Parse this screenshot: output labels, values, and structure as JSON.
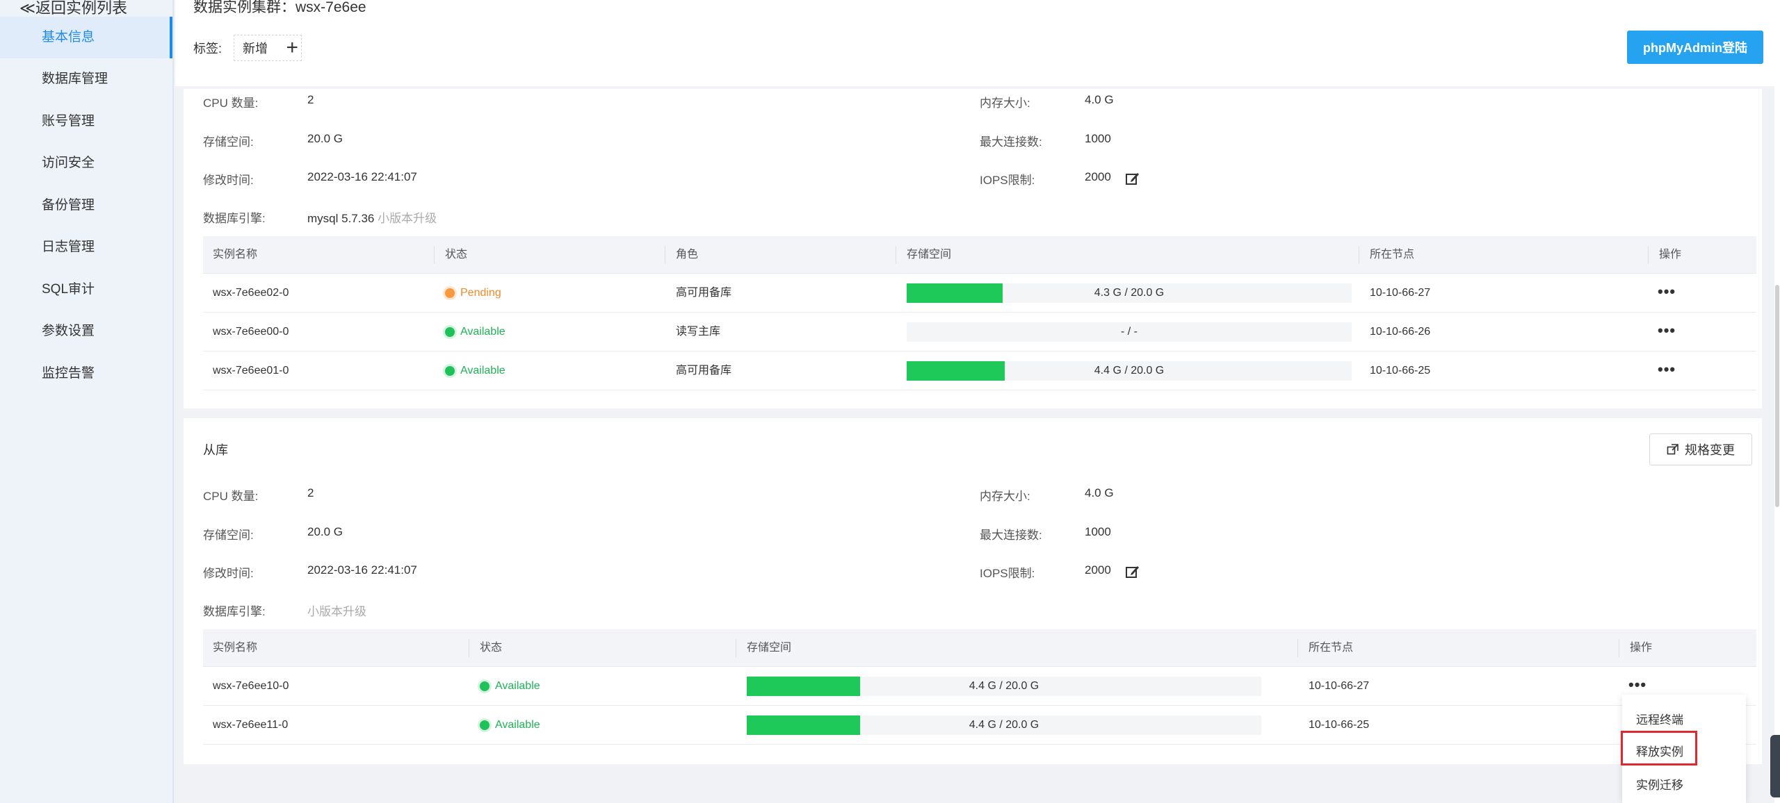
{
  "sidebar": {
    "back": "≪返回实例列表",
    "items": [
      {
        "label": "基本信息",
        "active": true
      },
      {
        "label": "数据库管理"
      },
      {
        "label": "账号管理"
      },
      {
        "label": "访问安全"
      },
      {
        "label": "备份管理"
      },
      {
        "label": "日志管理"
      },
      {
        "label": "SQL审计"
      },
      {
        "label": "参数设置"
      },
      {
        "label": "监控告警"
      }
    ]
  },
  "header": {
    "cluster_title": "数据实例集群：wsx-7e6ee",
    "tag_label": "标签:",
    "tag_add": "新增",
    "phpmyadmin": "phpMyAdmin登陆"
  },
  "primary": {
    "labels": {
      "cpu": "CPU 数量:",
      "storage": "存储空间:",
      "modified": "修改时间:",
      "engine": "数据库引擎:",
      "memory": "内存大小:",
      "max_conn": "最大连接数:",
      "iops": "IOPS限制:"
    },
    "values": {
      "cpu": "2",
      "storage": "20.0 G",
      "modified": "2022-03-16 22:41:07",
      "engine": "mysql 5.7.36",
      "engine_upgrade": "小版本升级",
      "memory": "4.0 G",
      "max_conn": "1000",
      "iops": "2000"
    },
    "table": {
      "headers": [
        "实例名称",
        "状态",
        "角色",
        "存储空间",
        "所在节点",
        "操作"
      ],
      "rows": [
        {
          "name": "wsx-7e6ee02-0",
          "status": "Pending",
          "role": "高可用备库",
          "storage": "4.3 G / 20.0 G",
          "fill": 0.215,
          "node": "10-10-66-27",
          "ops": "•••"
        },
        {
          "name": "wsx-7e6ee00-0",
          "status": "Available",
          "role": "读写主库",
          "storage": "- / -",
          "fill": 0,
          "node": "10-10-66-26",
          "ops": "•••"
        },
        {
          "name": "wsx-7e6ee01-0",
          "status": "Available",
          "role": "高可用备库",
          "storage": "4.4 G / 20.0 G",
          "fill": 0.22,
          "node": "10-10-66-25",
          "ops": "•••"
        }
      ]
    }
  },
  "replica": {
    "title": "从库",
    "spec_button": "规格变更",
    "labels": {
      "cpu": "CPU 数量:",
      "storage": "存储空间:",
      "modified": "修改时间:",
      "engine": "数据库引擎:",
      "memory": "内存大小:",
      "max_conn": "最大连接数:",
      "iops": "IOPS限制:"
    },
    "values": {
      "cpu": "2",
      "storage": "20.0 G",
      "modified": "2022-03-16 22:41:07",
      "engine_upgrade": "小版本升级",
      "memory": "4.0 G",
      "max_conn": "1000",
      "iops": "2000"
    },
    "table": {
      "headers": [
        "实例名称",
        "状态",
        "存储空间",
        "所在节点",
        "操作"
      ],
      "rows": [
        {
          "name": "wsx-7e6ee10-0",
          "status": "Available",
          "storage": "4.4 G / 20.0 G",
          "fill": 0.22,
          "node": "10-10-66-27",
          "ops": "•••"
        },
        {
          "name": "wsx-7e6ee11-0",
          "status": "Available",
          "storage": "4.4 G / 20.0 G",
          "fill": 0.22,
          "node": "10-10-66-25",
          "ops": "•••"
        }
      ]
    }
  },
  "dropdown": {
    "items": [
      "远程终端",
      "释放实例",
      "实例迁移"
    ]
  },
  "colors": {
    "accent": "#25a3f0",
    "pending": "#f79a3e",
    "available": "#1fc25a",
    "highlight": "#e0282e"
  }
}
